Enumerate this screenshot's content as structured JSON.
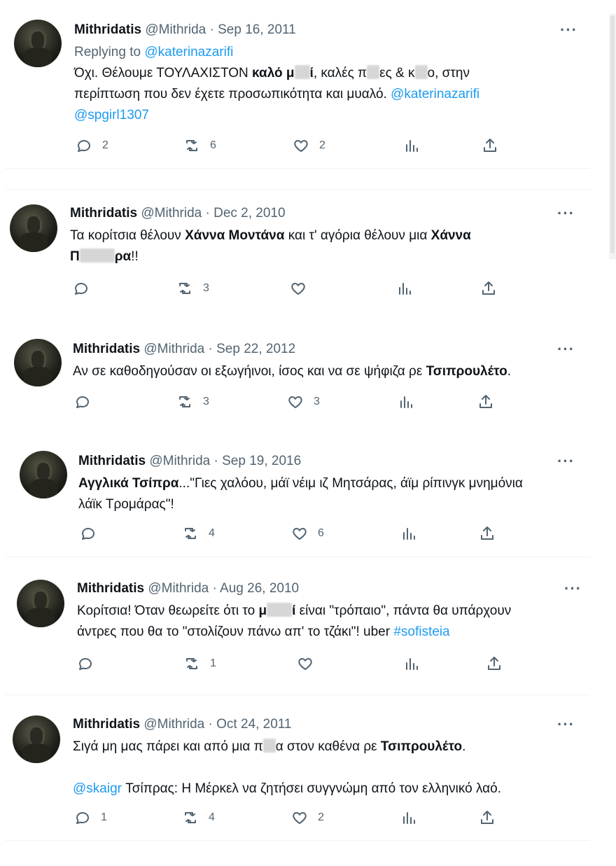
{
  "tweets": [
    {
      "name": "Mithridatis",
      "handle": "@Mithrida",
      "date": "· Sep 16, 2011",
      "replying_label": "Replying to",
      "replying_to": "@katerinazarifi",
      "text": {
        "p1": "Όχι. Θέλουμε ΤΟΥΛΑΧΙΣΤΟΝ ",
        "b1": "καλό μ",
        "b2": "ί",
        "p2": ", καλές π",
        "p3": "ες & κ",
        "p4": "ο, στην",
        "line2": "περίπτωση που δεν έχετε  προσωπικότητα και μυαλό. ",
        "mention1": "@katerinazarifi",
        "mention2": "@spgirl1307"
      },
      "replies": "2",
      "retweets": "6",
      "likes": "2"
    },
    {
      "name": "Mithridatis",
      "handle": "@Mithrida",
      "date": "· Dec 2, 2010",
      "text": {
        "p1": "Τα κορίτσια θέλουν ",
        "b1": "Χάννα Μοντάνα",
        "p2": " και τ' αγόρια θέλουν μια ",
        "b2": "Χάννα",
        "b3": "Π",
        "b4": "ρα",
        "p3": "!!"
      },
      "replies": "",
      "retweets": "3",
      "likes": ""
    },
    {
      "name": "Mithridatis",
      "handle": "@Mithrida",
      "date": "· Sep 22, 2012",
      "text": {
        "p1": "Αν σε καθοδηγούσαν οι εξωγήινοι, ίσος και να σε ψήφιζα ρε ",
        "b1": "Τσιπρουλέτο",
        "p2": "."
      },
      "replies": "",
      "retweets": "3",
      "likes": "3"
    },
    {
      "name": "Mithridatis",
      "handle": "@Mithrida",
      "date": "· Sep 19, 2016",
      "text": {
        "b1": "Αγγλικά Τσίπρα",
        "p1": "...\"Γιες χαλόου, μάϊ νέιμ ιζ Μητσάρας, άϊμ ρίπινγκ μνημόνια",
        "line2": "λάϊκ Τρομάρας\"!"
      },
      "replies": "",
      "retweets": "4",
      "likes": "6"
    },
    {
      "name": "Mithridatis",
      "handle": "@Mithrida",
      "date": "· Aug 26, 2010",
      "text": {
        "p1": "Κορίτσια! Όταν θεωρείτε ότι το ",
        "b1": "μ",
        "b2": "ί",
        "p2": " είναι \"τρόπαιο\", πάντα θα υπάρχουν",
        "line2": "άντρες που θα το \"στολίζουν πάνω απ' το τζάκι\"! uber ",
        "hashtag": "#sofisteia"
      },
      "replies": "",
      "retweets": "1",
      "likes": ""
    },
    {
      "name": "Mithridatis",
      "handle": "@Mithrida",
      "date": "· Oct 24, 2011",
      "text": {
        "p1": "Σιγά μη μας πάρει και από μια π",
        "p2": "α στον καθένα ρε ",
        "b1": "Τσιπρουλέτο",
        "p3": ".",
        "mention": "@skaigr",
        "line3": " Τσίπρας: Η Μέρκελ να ζητήσει συγγνώμη από τον ελληνικό λαό."
      },
      "replies": "1",
      "retweets": "4",
      "likes": "2"
    }
  ],
  "icons": {
    "reply": "reply-icon",
    "retweet": "retweet-icon",
    "like": "like-icon",
    "views": "views-icon",
    "share": "share-icon",
    "more": "more-icon"
  },
  "more_glyph": "···",
  "colors": {
    "link": "#1d9bf0",
    "secondary": "#536471",
    "text": "#0f1419"
  }
}
